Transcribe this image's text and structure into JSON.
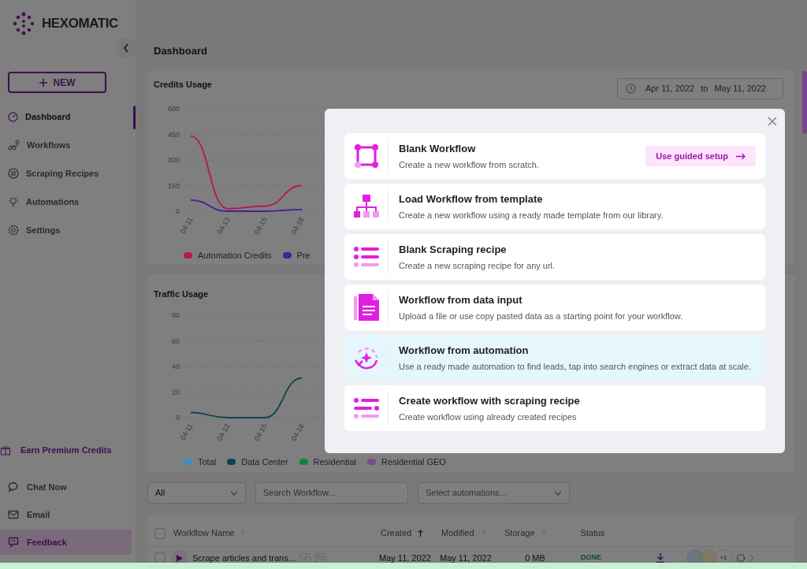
{
  "sidebar": {
    "logo": "HEXOMATIC",
    "new_button": "NEW",
    "items": [
      {
        "label": "Dashboard",
        "selected": true
      },
      {
        "label": "Workflows",
        "selected": false
      },
      {
        "label": "Scraping Recipes",
        "selected": false
      },
      {
        "label": "Automations",
        "selected": false
      },
      {
        "label": "Settings",
        "selected": false
      }
    ],
    "footer_items": [
      {
        "label": "Earn Premium Credits",
        "kind": "promo",
        "selected": false
      },
      {
        "label": "Chat Now",
        "kind": "link",
        "selected": false
      },
      {
        "label": "Email",
        "kind": "link",
        "selected": false
      },
      {
        "label": "Feedback",
        "kind": "link",
        "selected": true
      }
    ]
  },
  "page_title": "Dashboard",
  "credits_usage": {
    "title": "Credits Usage",
    "date_from": "Apr 11, 2022",
    "date_separator": "to",
    "date_to": "May 11, 2022",
    "chart_data": {
      "type": "line",
      "categories": [
        "04-11",
        "04-12",
        "04-15",
        "04-18"
      ],
      "yticks": [
        0,
        150,
        300,
        450,
        600
      ],
      "ylim": [
        0,
        600
      ],
      "grid": true,
      "legend": true,
      "series": [
        {
          "name": "Automation Credits",
          "color": "#b5175a",
          "values": [
            440,
            15,
            30,
            150
          ]
        },
        {
          "name": "Pre",
          "color": "#4c1d95",
          "values": [
            65,
            0,
            0,
            10
          ]
        }
      ]
    }
  },
  "traffic_usage": {
    "title": "Traffic Usage",
    "chart_data": {
      "type": "line",
      "categories": [
        "04-11",
        "04-12",
        "04-15",
        "04-18"
      ],
      "yticks": [
        0,
        20,
        40,
        60,
        80
      ],
      "ylim": [
        0,
        80
      ],
      "grid": true,
      "legend": true,
      "series": [
        {
          "name": "Total",
          "color": "#3a8fc4",
          "values": [
            null,
            null,
            null,
            null
          ]
        },
        {
          "name": "Data Center",
          "color": "#0d4350",
          "values": [
            4,
            0,
            0,
            31
          ]
        },
        {
          "name": "Residential",
          "color": "#15803d",
          "values": [
            null,
            null,
            null,
            null
          ]
        },
        {
          "name": "Residential GEO",
          "color": "#7e4a8f",
          "values": [
            null,
            null,
            null,
            null
          ]
        }
      ]
    }
  },
  "filters": {
    "status": "All",
    "search_placeholder": "Search Workflow...",
    "automations_placeholder": "Select automations..."
  },
  "table": {
    "select_all_checked": false,
    "columns": [
      {
        "label": "Workflow Name",
        "sorted": false
      },
      {
        "label": "Created",
        "sorted": true
      },
      {
        "label": "Modified",
        "sorted": false
      },
      {
        "label": "Storage",
        "sorted": false
      },
      {
        "label": "Status"
      }
    ],
    "rows": [
      {
        "checked": false,
        "name": "Scrape articles and trans...",
        "created": "May 11, 2022",
        "modified": "May 11, 2022",
        "storage": "0 MB",
        "status": "DONE",
        "extra_count": "+1"
      }
    ]
  },
  "modal": {
    "options": [
      {
        "title": "Blank Workflow",
        "description": "Create a new workflow from scratch.",
        "action": "Use guided setup",
        "selected": false
      },
      {
        "title": "Load Workflow from template",
        "description": "Create a new workflow using a ready made template from our library.",
        "selected": false
      },
      {
        "title": "Blank Scraping recipe",
        "description": "Create a new scraping recipe for any url.",
        "selected": false
      },
      {
        "title": "Workflow from data input",
        "description": "Upload a file or use copy pasted data as a starting point for your workflow.",
        "selected": false
      },
      {
        "title": "Workflow from automation",
        "description": "Use a ready made automation to find leads, tap into search engines or extract data at scale.",
        "selected": true
      },
      {
        "title": "Create workflow with scraping recipe",
        "description": "Create workflow using already created recipes",
        "selected": false
      }
    ]
  }
}
